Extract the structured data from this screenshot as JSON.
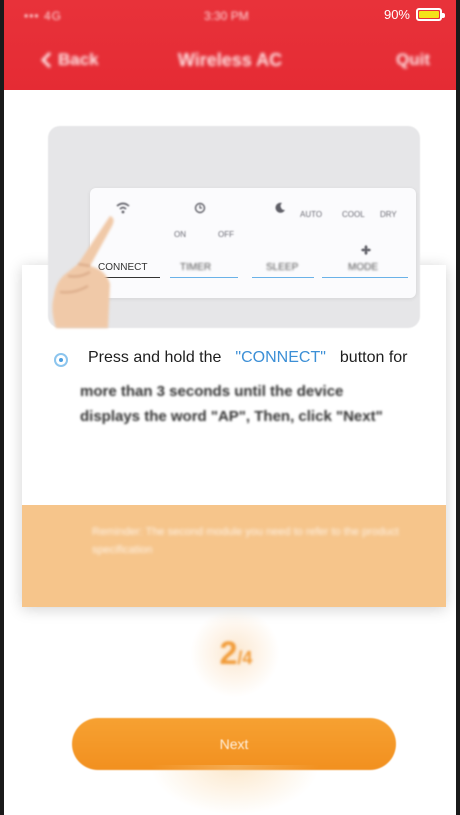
{
  "status_bar": {
    "carrier": "••• 4G",
    "time": "3:30 PM",
    "battery_percent": "90%",
    "battery_level": 0.9,
    "battery_color": "#f4e21a"
  },
  "header": {
    "back_label": "Back",
    "title": "Wireless AC",
    "action_label": "Quit",
    "background": "#e52b34"
  },
  "remote": {
    "icons": [
      "wifi-icon",
      "timer-icon",
      "sleep-icon",
      "fan-icon"
    ],
    "small_texts": [
      "ON",
      "OFF",
      "AUTO",
      "COOL",
      "DRY"
    ],
    "buttons": [
      "CONNECT",
      "TIMER",
      "SLEEP",
      "MODE"
    ]
  },
  "instruction": {
    "prefix": "Press and hold the",
    "highlight": "\"CONNECT\"",
    "suffix": "button for",
    "continuation": "more than 3 seconds until the device displays the word \"AP\", Then, click \"Next\""
  },
  "notice": {
    "text": "Reminder: The second module you need to refer to the product specification"
  },
  "progress": {
    "step": "2",
    "total": "/4"
  },
  "next_button": {
    "label": "Next",
    "color": "#f2901f"
  }
}
